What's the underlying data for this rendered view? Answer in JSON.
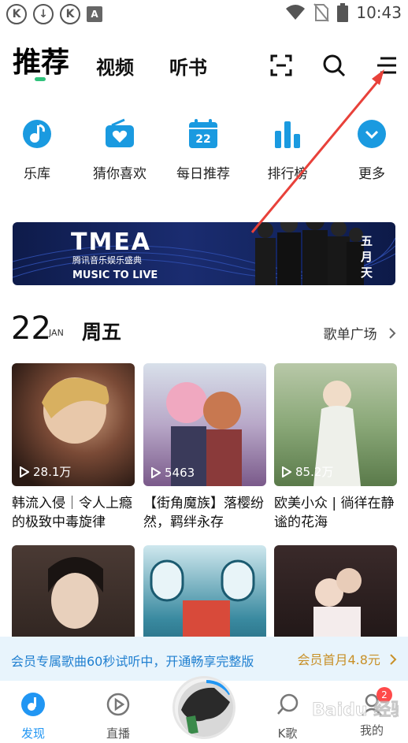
{
  "status_bar": {
    "left_icons": [
      "k-circle-icon",
      "download-circle-icon",
      "k-circle-icon",
      "a-square-icon"
    ],
    "time": "10:43"
  },
  "header": {
    "tabs": [
      {
        "label": "推荐",
        "active": true
      },
      {
        "label": "视频",
        "active": false
      },
      {
        "label": "听书",
        "active": false
      }
    ],
    "icons": [
      "scan-icon",
      "search-icon",
      "menu-icon"
    ]
  },
  "quick_menu": [
    {
      "label": "乐库",
      "icon": "music-note-icon"
    },
    {
      "label": "猜你喜欢",
      "icon": "radio-heart-icon"
    },
    {
      "label": "每日推荐",
      "icon": "calendar-icon",
      "icon_text": "22"
    },
    {
      "label": "排行榜",
      "icon": "bar-chart-icon"
    },
    {
      "label": "更多",
      "icon": "chevron-down-circle-icon"
    }
  ],
  "banner": {
    "logo": "TMEA",
    "subtitle": "腾讯音乐娱乐盛典",
    "tagline": "MUSIC TO LIVE",
    "side_text": "五月天"
  },
  "date_row": {
    "day_num": "22",
    "month": "JAN",
    "weekday": "周五",
    "link": "歌单广场"
  },
  "playlists": [
    {
      "title": "韩流入侵｜令人上瘾的极致中毒旋律",
      "plays": "28.1万"
    },
    {
      "title": "【街角魔族】落樱纷然，羁绊永存",
      "plays": "5463"
    },
    {
      "title": "欧美小众 | 徜徉在静谧的花海",
      "plays": "85.2万"
    }
  ],
  "promo": {
    "text": "会员专属歌曲60秒试听中，开通畅享完整版",
    "button": "会员首月4.8元"
  },
  "bottom_nav": [
    {
      "label": "发现",
      "active": true
    },
    {
      "label": "直播",
      "active": false
    },
    {
      "label": "K歌",
      "active": false
    },
    {
      "label": "我的",
      "active": false,
      "badge": "2"
    }
  ],
  "watermark": "Baidu 经验",
  "colors": {
    "accent_green": "#31c27c",
    "accent_blue": "#2196f3",
    "promo_text": "#1f7fd0",
    "promo_button": "#c89028",
    "annotation_arrow": "#e8413a"
  }
}
